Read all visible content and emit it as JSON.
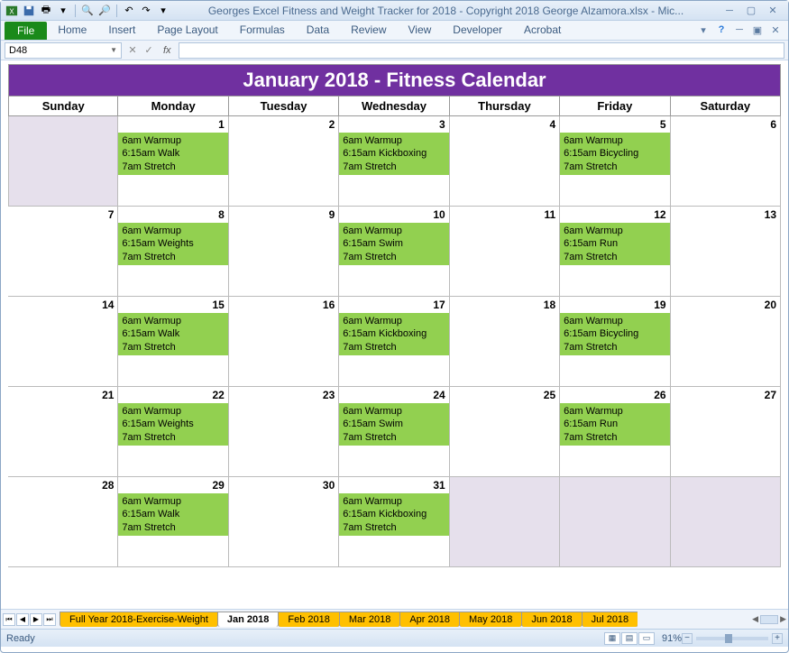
{
  "window": {
    "title": "Georges Excel Fitness and Weight Tracker for 2018 - Copyright 2018 George Alzamora.xlsx  -  Mic..."
  },
  "ribbon": {
    "file": "File",
    "tabs": [
      "Home",
      "Insert",
      "Page Layout",
      "Formulas",
      "Data",
      "Review",
      "View",
      "Developer",
      "Acrobat"
    ]
  },
  "formula": {
    "name_box": "D48",
    "fx": "fx",
    "value": ""
  },
  "calendar": {
    "title": "January 2018  -  Fitness Calendar",
    "day_names": [
      "Sunday",
      "Monday",
      "Tuesday",
      "Wednesday",
      "Thursday",
      "Friday",
      "Saturday"
    ],
    "weeks": [
      [
        {
          "day": "",
          "grey": true,
          "events": []
        },
        {
          "day": "1",
          "events": [
            "6am Warmup",
            "6:15am Walk",
            "7am Stretch"
          ]
        },
        {
          "day": "2",
          "events": []
        },
        {
          "day": "3",
          "events": [
            "6am Warmup",
            "6:15am Kickboxing",
            "7am Stretch"
          ]
        },
        {
          "day": "4",
          "events": []
        },
        {
          "day": "5",
          "events": [
            "6am Warmup",
            "6:15am Bicycling",
            "7am Stretch"
          ]
        },
        {
          "day": "6",
          "events": []
        }
      ],
      [
        {
          "day": "7",
          "events": []
        },
        {
          "day": "8",
          "events": [
            "6am Warmup",
            "6:15am Weights",
            "7am Stretch"
          ]
        },
        {
          "day": "9",
          "events": []
        },
        {
          "day": "10",
          "events": [
            "6am Warmup",
            "6:15am Swim",
            "7am Stretch"
          ]
        },
        {
          "day": "11",
          "events": []
        },
        {
          "day": "12",
          "events": [
            "6am Warmup",
            "6:15am Run",
            "7am Stretch"
          ]
        },
        {
          "day": "13",
          "events": []
        }
      ],
      [
        {
          "day": "14",
          "events": []
        },
        {
          "day": "15",
          "events": [
            "6am Warmup",
            "6:15am Walk",
            "7am Stretch"
          ]
        },
        {
          "day": "16",
          "events": []
        },
        {
          "day": "17",
          "events": [
            "6am Warmup",
            "6:15am Kickboxing",
            "7am Stretch"
          ]
        },
        {
          "day": "18",
          "events": []
        },
        {
          "day": "19",
          "events": [
            "6am Warmup",
            "6:15am Bicycling",
            "7am Stretch"
          ]
        },
        {
          "day": "20",
          "events": []
        }
      ],
      [
        {
          "day": "21",
          "events": []
        },
        {
          "day": "22",
          "events": [
            "6am Warmup",
            "6:15am Weights",
            "7am Stretch"
          ]
        },
        {
          "day": "23",
          "events": []
        },
        {
          "day": "24",
          "events": [
            "6am Warmup",
            "6:15am Swim",
            "7am Stretch"
          ]
        },
        {
          "day": "25",
          "events": []
        },
        {
          "day": "26",
          "events": [
            "6am Warmup",
            "6:15am Run",
            "7am Stretch"
          ]
        },
        {
          "day": "27",
          "events": []
        }
      ],
      [
        {
          "day": "28",
          "events": []
        },
        {
          "day": "29",
          "events": [
            "6am Warmup",
            "6:15am Walk",
            "7am Stretch"
          ]
        },
        {
          "day": "30",
          "events": []
        },
        {
          "day": "31",
          "events": [
            "6am Warmup",
            "6:15am Kickboxing",
            "7am Stretch"
          ]
        },
        {
          "day": "",
          "grey": true,
          "events": []
        },
        {
          "day": "",
          "grey": true,
          "events": []
        },
        {
          "day": "",
          "grey": true,
          "events": []
        }
      ]
    ]
  },
  "sheet_tabs": {
    "tabs": [
      "Full Year 2018-Exercise-Weight",
      "Jan 2018",
      "Feb 2018",
      "Mar 2018",
      "Apr 2018",
      "May 2018",
      "Jun 2018",
      "Jul 2018"
    ],
    "active": "Jan 2018"
  },
  "status": {
    "ready": "Ready",
    "zoom": "91%"
  }
}
